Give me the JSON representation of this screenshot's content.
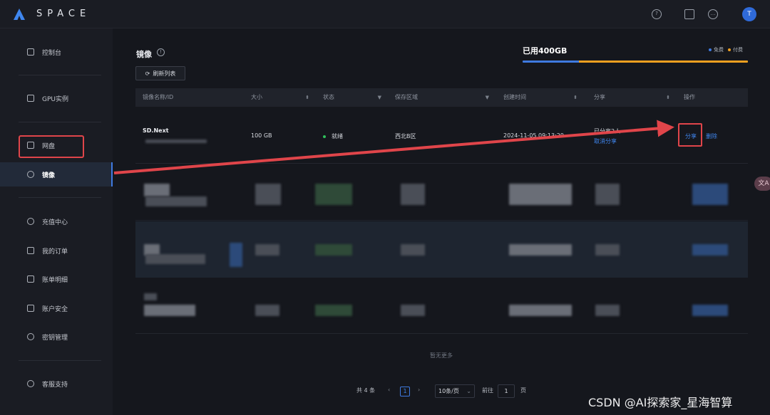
{
  "topbar": {
    "brand": "SPACE",
    "icons": [
      "help-icon",
      "book-icon",
      "chat-icon"
    ],
    "avatar_initial": "T"
  },
  "sidebar": {
    "items": [
      {
        "label": "控制台",
        "icon": "home-icon"
      },
      {
        "label": "GPU实例",
        "icon": "gpu-icon"
      },
      {
        "label": "网盘",
        "icon": "disk-icon"
      },
      {
        "label": "镜像",
        "icon": "image-icon",
        "active": true
      },
      {
        "label": "充值中心",
        "icon": "wallet-icon"
      },
      {
        "label": "我的订单",
        "icon": "order-icon"
      },
      {
        "label": "账单明细",
        "icon": "bill-icon"
      },
      {
        "label": "账户安全",
        "icon": "shield-icon"
      },
      {
        "label": "密钥管理",
        "icon": "key-icon"
      },
      {
        "label": "客服支持",
        "icon": "support-icon"
      }
    ]
  },
  "main": {
    "title": "镜像",
    "refresh_label": "刷新列表",
    "storage": {
      "used_label": "已用400GB",
      "legend_free": "免费",
      "legend_paid": "付费",
      "free_fraction": 0.25,
      "paid_fraction": 0.75,
      "color_free": "#3f7ae0",
      "color_paid": "#f0a020"
    },
    "table": {
      "columns": [
        "镜像名称/ID",
        "大小",
        "状态",
        "保存区域",
        "创建时间",
        "分享",
        "操作"
      ],
      "rows": [
        {
          "name": "SD.Next",
          "size": "100 GB",
          "status": "就绪",
          "region": "西北B区",
          "created": "2024-11-05 09:13:29",
          "share_info": "已分享2人",
          "share_cancel": "取消分享",
          "action_share": "分享",
          "action_delete": "删除"
        }
      ],
      "empty_text": "暂无更多"
    },
    "pagination": {
      "total": "共 4 条",
      "current_page": "1",
      "per_page": "10条/页",
      "goto_label": "前往",
      "goto_value": "1",
      "page_suffix": "页"
    }
  },
  "watermark": "CSDN @AI探索家_星海智算",
  "float_pill": "文A"
}
